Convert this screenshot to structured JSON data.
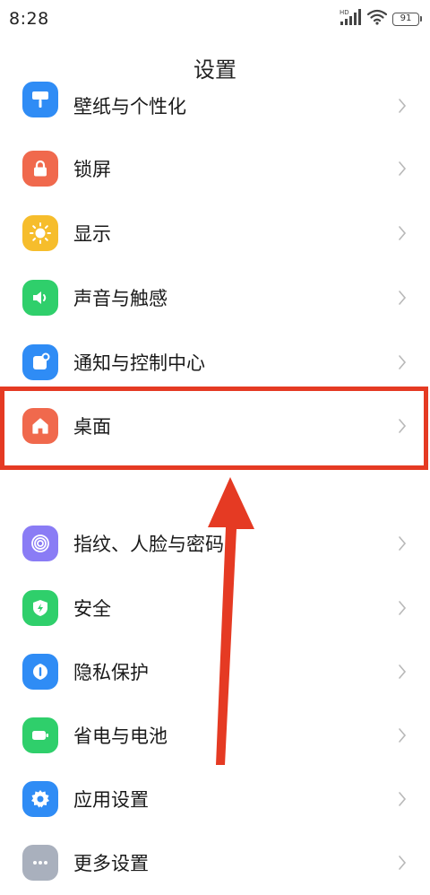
{
  "status_bar": {
    "time": "8:28",
    "battery": "91",
    "network_badge": "HD",
    "icons": [
      "signal-icon",
      "wifi-icon",
      "battery-icon"
    ]
  },
  "header": {
    "title": "设置"
  },
  "settings": {
    "items": [
      {
        "label": "壁纸与个性化",
        "icon": "wallpaper-brush-icon",
        "color": "#2f8cf5"
      },
      {
        "label": "锁屏",
        "icon": "lock-icon",
        "color": "#f0694d"
      },
      {
        "label": "显示",
        "icon": "sun-icon",
        "color": "#f6bd2c"
      },
      {
        "label": "声音与触感",
        "icon": "speaker-icon",
        "color": "#2fcf6b"
      },
      {
        "label": "通知与控制中心",
        "icon": "notification-icon",
        "color": "#2f8cf5"
      },
      {
        "label": "桌面",
        "icon": "home-icon",
        "color": "#f0694d"
      },
      {
        "label": "指纹、人脸与密码",
        "icon": "fingerprint-icon",
        "color": "#8a7cf5"
      },
      {
        "label": "安全",
        "icon": "shield-icon",
        "color": "#2fcf6b"
      },
      {
        "label": "隐私保护",
        "icon": "privacy-icon",
        "color": "#2f8cf5"
      },
      {
        "label": "省电与电池",
        "icon": "battery-saver-icon",
        "color": "#2fcf6b"
      },
      {
        "label": "应用设置",
        "icon": "gear-icon",
        "color": "#2f8cf5"
      },
      {
        "label": "更多设置",
        "icon": "more-icon",
        "color": "#a9b0bd"
      }
    ]
  },
  "annotation": {
    "color": "#e53a23",
    "highlighted_item": "桌面"
  }
}
